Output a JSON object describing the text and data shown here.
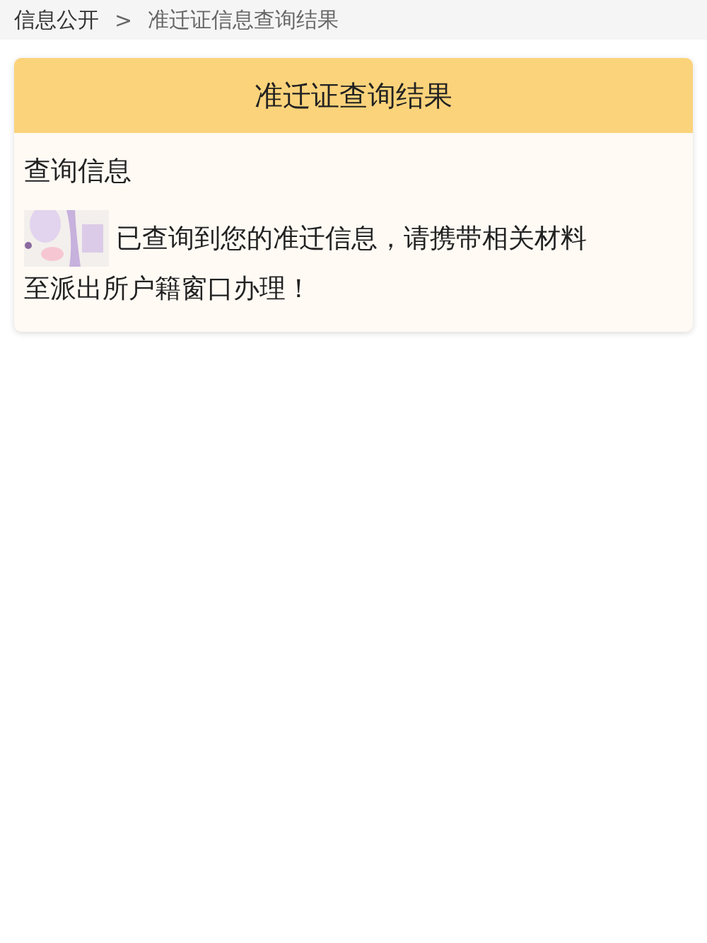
{
  "breadcrumb": [
    {
      "label": "信息公开"
    },
    {
      "label": "准迁证信息查询结果"
    }
  ],
  "breadcrumb_separator": ">",
  "card": {
    "title": "准迁证查询结果",
    "section_label": "查询信息",
    "message_lines": [
      "已查询到您的准迁信息，请携带相关材料",
      "至派出所户籍窗口办理！"
    ]
  }
}
